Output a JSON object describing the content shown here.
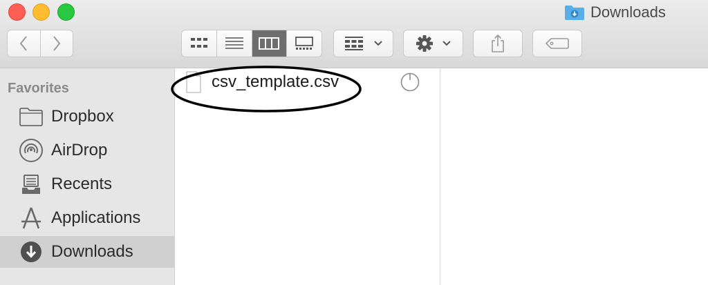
{
  "window": {
    "title": "Downloads",
    "title_icon": "downloads-folder-icon"
  },
  "toolbar": {
    "back_icon": "chevron-left-icon",
    "forward_icon": "chevron-right-icon",
    "view_modes": [
      {
        "name": "icon-view",
        "icon": "grid-icon",
        "active": false
      },
      {
        "name": "list-view",
        "icon": "list-icon",
        "active": false
      },
      {
        "name": "column-view",
        "icon": "columns-icon",
        "active": true
      },
      {
        "name": "gallery-view",
        "icon": "gallery-icon",
        "active": false
      }
    ],
    "arrange_icon": "arrange-grid-icon",
    "action_icon": "gear-icon",
    "share_icon": "share-icon",
    "tag_icon": "tag-icon"
  },
  "sidebar": {
    "heading": "Favorites",
    "items": [
      {
        "label": "Dropbox",
        "icon": "folder-icon",
        "selected": false
      },
      {
        "label": "AirDrop",
        "icon": "airdrop-icon",
        "selected": false
      },
      {
        "label": "Recents",
        "icon": "recents-icon",
        "selected": false
      },
      {
        "label": "Applications",
        "icon": "applications-icon",
        "selected": false
      },
      {
        "label": "Downloads",
        "icon": "download-circle-icon",
        "selected": true
      }
    ]
  },
  "files": [
    {
      "name": "csv_template.csv",
      "icon": "document-icon",
      "status_icon": "progress-circle-icon"
    }
  ],
  "colors": {
    "close": "#fd5f57",
    "minimize": "#febc2e",
    "maximize": "#28c840",
    "active_segment": "#6e6e6e",
    "sidebar_selected": "#d0d0d0",
    "folder_blue": "#5aaee8"
  }
}
